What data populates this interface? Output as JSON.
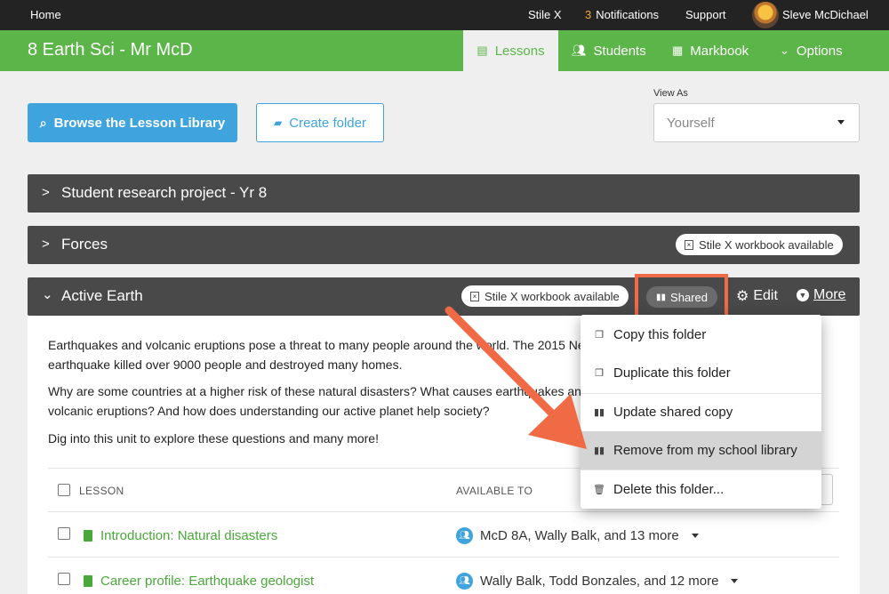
{
  "topbar": {
    "home": "Home",
    "stilex": "Stile X",
    "notifications_count": "3",
    "notifications_label": "Notifications",
    "support": "Support",
    "user_name": "Sleve McDichael"
  },
  "classbar": {
    "title": "8 Earth Sci - Mr McD",
    "tabs": [
      {
        "label": "Lessons",
        "icon": "document-icon",
        "active": true
      },
      {
        "label": "Students",
        "icon": "users-icon",
        "active": false
      },
      {
        "label": "Markbook",
        "icon": "grid-icon",
        "active": false
      },
      {
        "label": "Options",
        "icon": "chevron-circle-icon",
        "active": false
      }
    ]
  },
  "actions": {
    "browse_label": "Browse the Lesson Library",
    "create_label": "Create folder",
    "view_as_label": "View As",
    "view_as_value": "Yourself"
  },
  "folders": [
    {
      "name": "Student research project - Yr 8",
      "expanded": false
    },
    {
      "name": "Forces",
      "expanded": false,
      "badge": "Stile X workbook available"
    },
    {
      "name": "Active Earth",
      "expanded": true,
      "badge": "Stile X workbook available",
      "shared_label": "Shared",
      "edit_label": "Edit",
      "more_label": "More"
    }
  ],
  "active_folder": {
    "description": [
      "Earthquakes and volcanic eruptions pose a threat to many people around the world. The 2015 Nepal earthquake killed over 9000 people and destroyed many homes.",
      "Why are some countries at a higher risk of these natural disasters? What causes earthquakes and volcanic eruptions? And how does understanding our active planet help society?",
      "Dig into this unit to explore these questions and many more!"
    ],
    "columns": {
      "lesson": "LESSON",
      "available_to": "AVAILABLE TO"
    },
    "lessons": [
      {
        "title": "Introduction: Natural disasters",
        "available_to": "McD 8A, Wally Balk, and 13 more"
      },
      {
        "title": "Career profile: Earthquake geologist",
        "available_to": "Wally Balk, Todd Bonzales, and 12 more"
      }
    ]
  },
  "more_menu": {
    "items": [
      {
        "label": "Copy this folder",
        "icon": "copy-icon"
      },
      {
        "label": "Duplicate this folder",
        "icon": "copy-icon"
      },
      {
        "label": "Update shared copy",
        "icon": "library-icon"
      },
      {
        "label": "Remove from my school library",
        "icon": "library-icon",
        "highlighted": true
      },
      {
        "label": "Delete this folder...",
        "icon": "trash-icon"
      }
    ]
  },
  "colors": {
    "brand_green": "#5bb548",
    "accent_blue": "#3fa3dd",
    "annotation_red": "#ef6a45",
    "folder_bar": "#494949"
  }
}
